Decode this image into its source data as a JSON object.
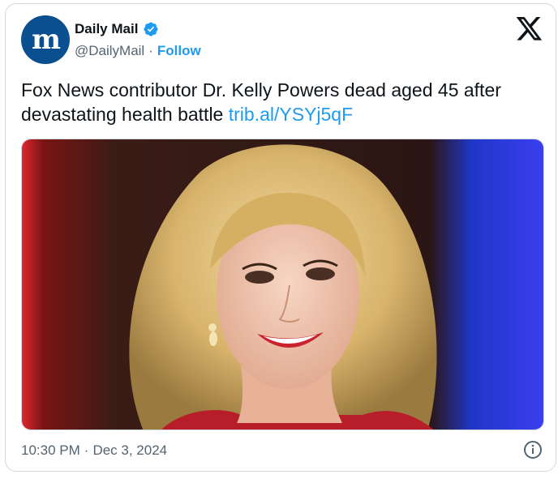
{
  "account": {
    "name": "Daily Mail",
    "handle": "@DailyMail",
    "separator": "·",
    "follow_label": "Follow",
    "avatar_letter": "m",
    "verified_icon": "verified-badge-icon",
    "brand_color": "#0a4f8f"
  },
  "tweet": {
    "text": "Fox News contributor Dr. Kelly Powers dead aged 45 after devastating health battle",
    "link": "trib.al/YSYj5qF",
    "image": {
      "icon": "photo-woman-blonde-smiling"
    }
  },
  "meta": {
    "time": "10:30 PM",
    "separator": "·",
    "date": "Dec 3, 2024"
  },
  "icons": {
    "platform_logo": "x-logo-icon",
    "info": "info-icon"
  },
  "colors": {
    "link": "#1d9bf0",
    "secondary_text": "#536471",
    "primary_text": "#0f1419"
  }
}
